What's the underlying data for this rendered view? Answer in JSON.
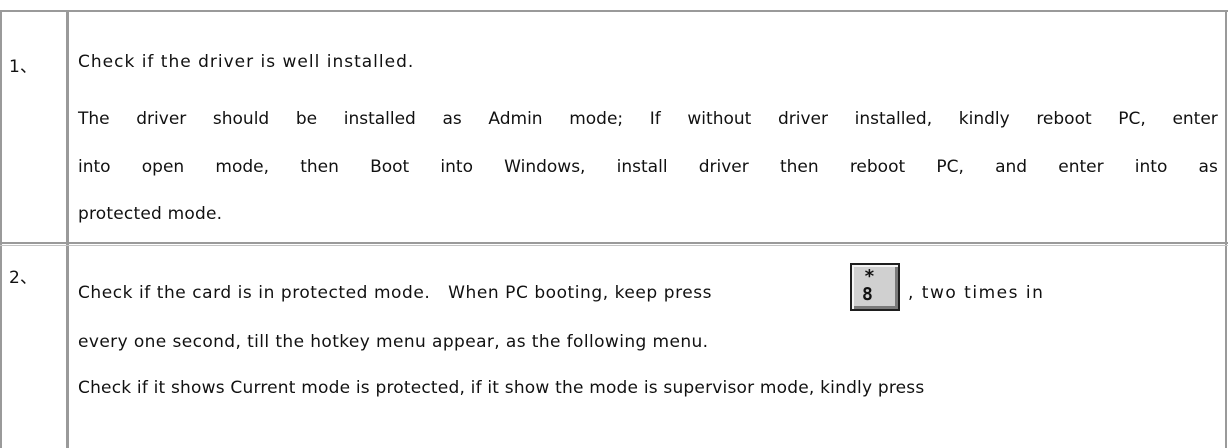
{
  "rows": [
    {
      "number": "1、",
      "heading": "Check if the driver is well installed.",
      "body_lines": [
        "The driver should be installed as Admin mode; If without driver installed, kindly reboot PC, enter",
        "into open mode, then Boot into Windows, install driver then reboot PC, and enter into as"
      ],
      "body_last": "protected mode."
    },
    {
      "number": "2、",
      "line1_before_key": "Check if the card is in protected mode.   When PC booting, keep press",
      "line1_after_key": ", two times in",
      "key": {
        "top": "*",
        "bottom": "8"
      },
      "line2": "every one second, till the hotkey menu appear, as the following menu.",
      "line3": "Check if it shows Current mode is protected, if it show the mode is supervisor mode, kindly press"
    }
  ]
}
